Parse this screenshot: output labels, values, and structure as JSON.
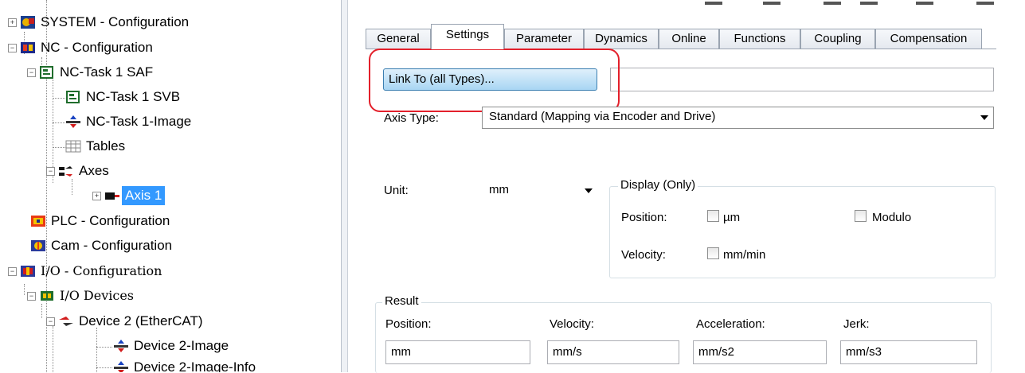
{
  "tree": {
    "items": [
      {
        "label": "SYSTEM - Configuration"
      },
      {
        "label": "NC - Configuration"
      },
      {
        "label": "NC-Task 1 SAF"
      },
      {
        "label": "NC-Task 1 SVB"
      },
      {
        "label": "NC-Task 1-Image"
      },
      {
        "label": "Tables"
      },
      {
        "label": "Axes"
      },
      {
        "label": "Axis 1"
      },
      {
        "label": "PLC - Configuration"
      },
      {
        "label": "Cam - Configuration"
      },
      {
        "label": "I/O - Configuration"
      },
      {
        "label": "I/O Devices"
      },
      {
        "label": "Device 2 (EtherCAT)"
      },
      {
        "label": "Device 2-Image"
      },
      {
        "label": "Device 2-Image-Info"
      }
    ]
  },
  "tabs": [
    "General",
    "Settings",
    "Parameter",
    "Dynamics",
    "Online",
    "Functions",
    "Coupling",
    "Compensation"
  ],
  "active_tab": "Settings",
  "settings": {
    "link_button": "Link To (all Types)...",
    "link_value": "",
    "axis_type_label": "Axis Type:",
    "axis_type_value": "Standard (Mapping via Encoder and Drive)",
    "unit_label": "Unit:",
    "unit_value": "mm",
    "display_group_title": "Display (Only)",
    "position_label": "Position:",
    "position_check_label": "µm",
    "modulo_label": "Modulo",
    "velocity_label": "Velocity:",
    "velocity_check_label": "mm/min",
    "result_title": "Result",
    "result_position_label": "Position:",
    "result_velocity_label": "Velocity:",
    "result_acceleration_label": "Acceleration:",
    "result_jerk_label": "Jerk:",
    "result_position_value": "mm",
    "result_velocity_value": "mm/s",
    "result_acceleration_value": "mm/s2",
    "result_jerk_value": "mm/s3"
  },
  "colors": {
    "selection": "#3399ff",
    "highlight_ring": "#e3202b",
    "button_fill": "#a8d6f3"
  }
}
